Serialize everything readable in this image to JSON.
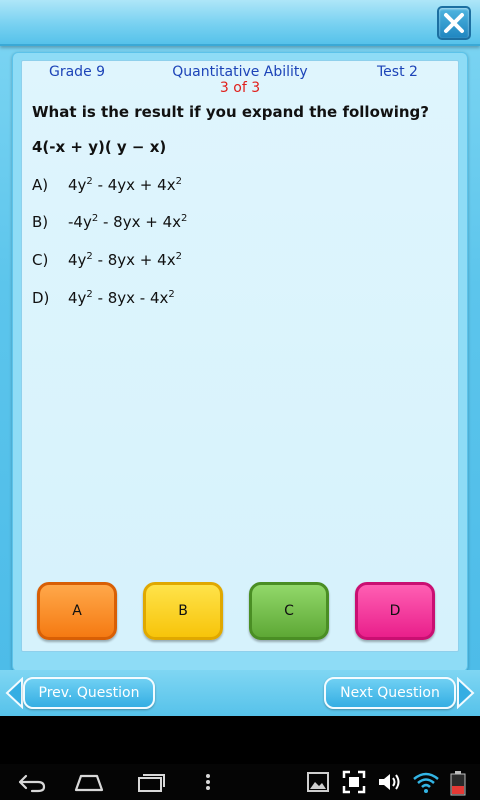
{
  "header": {
    "grade": "Grade 9",
    "subject": "Quantitative Ability",
    "progress": "3 of 3",
    "test": "Test 2"
  },
  "question": {
    "prompt": "What is the result if you expand the following?",
    "expression": "4(-x  + y)( y − x)"
  },
  "options": [
    {
      "letter": "A)",
      "terms": [
        "4y",
        "2",
        " - 4yx + 4x",
        "2"
      ]
    },
    {
      "letter": "B)",
      "terms": [
        "-4y",
        "2",
        " - 8yx + 4x",
        "2"
      ]
    },
    {
      "letter": "C)",
      "terms": [
        "4y",
        "2",
        " - 8yx + 4x",
        "2"
      ]
    },
    {
      "letter": "D)",
      "terms": [
        "4y",
        "2",
        " - 8yx - 4x",
        "2"
      ]
    }
  ],
  "answer_buttons": {
    "a": "A",
    "b": "B",
    "c": "C",
    "d": "D"
  },
  "navigation": {
    "prev_label": "Prev. Question",
    "next_label": "Next Question"
  },
  "icons": {
    "close": "close-icon",
    "back": "back-icon",
    "home": "home-icon",
    "recents": "recent-apps-icon",
    "menu": "overflow-menu-icon",
    "gallery": "gallery-icon",
    "screenshot": "screenshot-icon",
    "volume": "volume-icon",
    "wifi": "wifi-icon",
    "battery": "battery-icon"
  },
  "colors": {
    "header_text": "#1d44b8",
    "progress_text": "#e0201c",
    "option_a": "#f57a12",
    "option_b": "#f7c40a",
    "option_c": "#5ea835",
    "option_d": "#e91f8b"
  }
}
